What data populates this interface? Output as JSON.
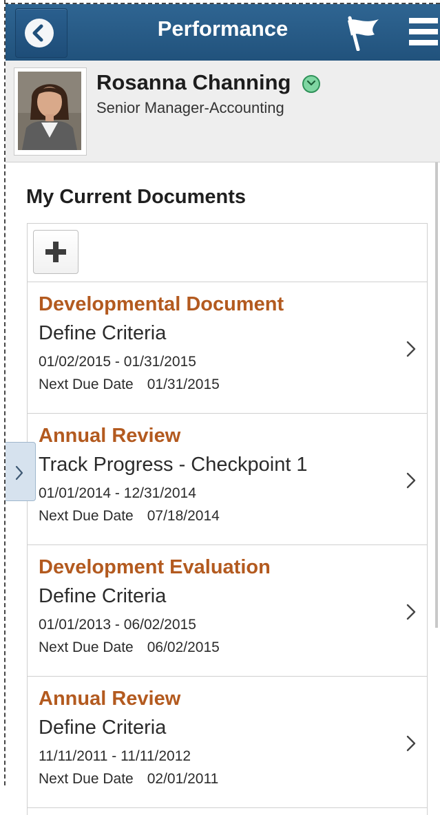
{
  "header": {
    "title": "Performance",
    "back_icon": "chevron-left-circle-icon",
    "flag_icon": "flag-icon",
    "menu_icon": "hamburger-menu-icon"
  },
  "profile": {
    "name": "Rosanna Channing",
    "job_title": "Senior Manager-Accounting",
    "status_icon": "chevron-down-circle-icon"
  },
  "section": {
    "title": "My Current Documents",
    "add_icon": "plus-icon"
  },
  "documents": [
    {
      "title": "Developmental Document",
      "status": "Define Criteria",
      "period": "01/02/2015 - 01/31/2015",
      "due_label": "Next Due Date",
      "due_date": "01/31/2015"
    },
    {
      "title": "Annual Review",
      "status": "Track Progress - Checkpoint 1",
      "period": "01/01/2014 - 12/31/2014",
      "due_label": "Next Due Date",
      "due_date": "07/18/2014"
    },
    {
      "title": "Development Evaluation",
      "status": "Define Criteria",
      "period": "01/01/2013 - 06/02/2015",
      "due_label": "Next Due Date",
      "due_date": "06/02/2015"
    },
    {
      "title": "Annual Review",
      "status": "Define Criteria",
      "period": "11/11/2011 - 11/11/2012",
      "due_label": "Next Due Date",
      "due_date": "02/01/2011"
    }
  ],
  "colors": {
    "header": "#2a5d8a",
    "doc_title": "#b35a1f",
    "profile_bg": "#eeeeee"
  }
}
